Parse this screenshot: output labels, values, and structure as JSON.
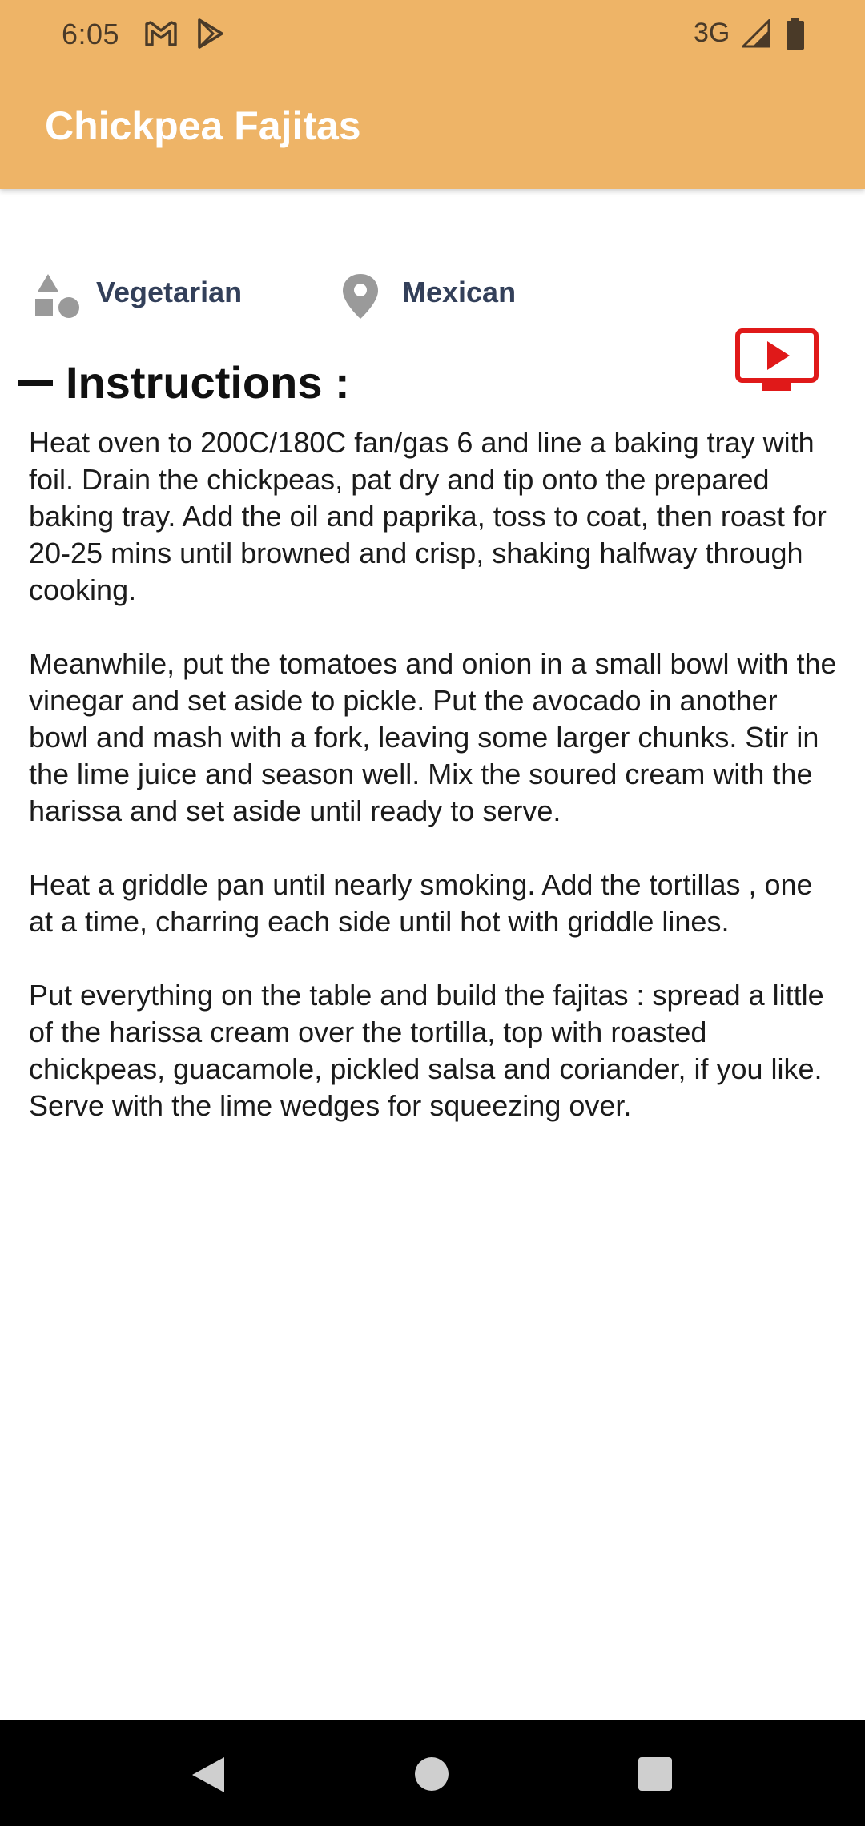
{
  "status_bar": {
    "time": "6:05",
    "network": "3G",
    "icons": [
      "gmail-icon",
      "play-store-icon",
      "signal-icon",
      "battery-icon"
    ]
  },
  "app_bar": {
    "title": "Chickpea Fajitas",
    "color": "#EEB467"
  },
  "meta": {
    "category": {
      "icon": "category-icon",
      "label": "Vegetarian"
    },
    "area": {
      "icon": "location-pin-icon",
      "label": "Mexican"
    }
  },
  "youtube_button": {
    "icon": "youtube-play-icon",
    "color": "#E01919"
  },
  "instructions": {
    "heading": "Instructions :",
    "paragraphs": [
      "Heat oven to 200C/180C fan/gas 6 and line a baking tray with foil. Drain the chickpeas, pat dry and tip onto the prepared baking tray. Add the oil and paprika, toss to coat, then roast for 20-25 mins until browned and crisp, shaking halfway through cooking.",
      "Meanwhile, put the tomatoes and onion in a small bowl with the vinegar and set aside to pickle. Put the avocado in another bowl and mash with a fork, leaving some larger chunks. Stir in the lime juice and season well. Mix the soured cream with the harissa and set aside until ready to serve.",
      "Heat a griddle pan until nearly smoking. Add the tortillas , one at a time, charring each side until hot with griddle lines.",
      "Put everything on the table and build the fajitas : spread a little of the harissa cream over the tortilla, top with roasted chickpeas, guacamole, pickled salsa and coriander, if you like. Serve with the lime wedges for squeezing over."
    ]
  },
  "nav_bar": {
    "buttons": [
      "back-icon",
      "home-icon",
      "recents-icon"
    ]
  }
}
